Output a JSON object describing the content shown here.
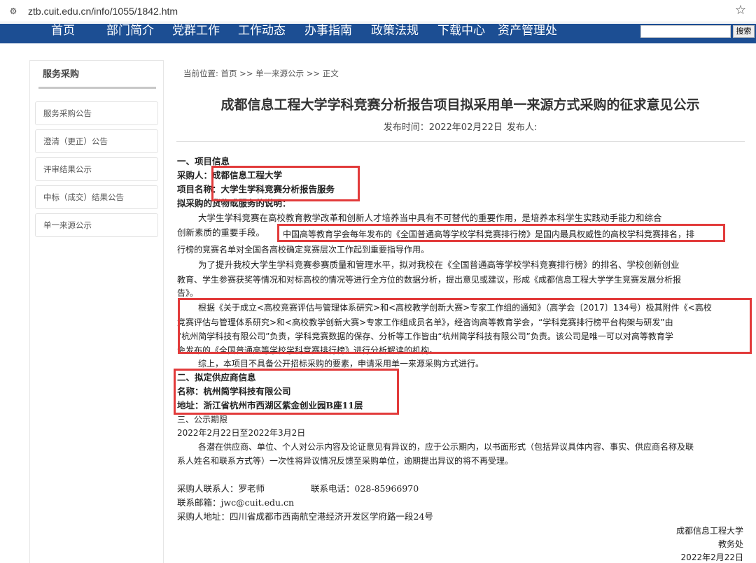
{
  "browser": {
    "url": "ztb.cuit.edu.cn/info/1055/1842.htm"
  },
  "nav": {
    "items": [
      "首页",
      "部门简介",
      "党群工作",
      "工作动态",
      "办事指南",
      "政策法规",
      "下载中心",
      "资产管理处"
    ],
    "search_button": "搜索",
    "search_placeholder": ""
  },
  "sidebar": {
    "title": "服务采购",
    "items": [
      "服务采购公告",
      "澄清（更正）公告",
      "评审结果公示",
      "中标（成交）结果公告",
      "单一来源公示"
    ]
  },
  "breadcrumb": {
    "label": "当前位置:",
    "path": "首页 >> 单一来源公示 >> 正文"
  },
  "article": {
    "title": "成都信息工程大学学科竞赛分析报告项目拟采用单一来源方式采购的征求意见公示",
    "publish_time": "发布时间：2022年02月22日",
    "publisher": "发布人:",
    "lines": [
      "一、项目信息",
      "采购人：成都信息工程大学",
      "项目名称：大学生学科竞赛分析报告服务",
      "拟采购的货物或服务的说明：",
      "大学生学科竞赛在高校教育教学改革和创新人才培养当中具有不可替代的重要作用，是培养本科学生实践动手能力和综合",
      "创新素质的重要手段。",
      "中国高等教育学会每年发布的《全国普通高等学校学科竞赛排行榜》是国内最具权威性的高校学科竞赛排名，排",
      "行榜的竞赛名单对全国各高校确定竞赛层次工作起到重要指导作用。",
      "为了提升我校大学生学科竞赛参赛质量和管理水平，拟对我校在《全国普通高等学校学科竞赛排行榜》的排名、学校创新创业",
      "教育、学生参赛获奖等情况和对标高校的情况等进行全方位的数据分析，提出意见或建议，形成《成都信息工程大学学生竞赛发展分析报",
      "告》。",
      "根据《关于成立<高校竞赛评估与管理体系研究>和<高校教学创新大赛>专家工作组的通知》（高学会〔2017〕134号）极其附件《<高校",
      "竞赛评估与管理体系研究>和<高校教学创新大赛>专家工作组成员名单》，经咨询高等教育学会，“学科竞赛排行榜平台构架与研发”由",
      "“杭州简学科技有限公司”负责，学科竞赛数据的保存、分析等工作皆由“杭州简学科技有限公司”负责。该公司是唯一可以对高等教育学",
      "会发布的《全国普通高等学校学科竞赛排行榜》进行分析解读的机构。",
      "综上，本项目不具备公开招标采购的要素，申请采用单一来源采购方式进行。",
      "二、拟定供应商信息",
      "名称：杭州简学科技有限公司",
      "地址：浙江省杭州市西湖区紫金创业园B座11层",
      "三、公示期限",
      "2022年2月22日至2022年3月2日",
      "各潜在供应商、单位、个人对公示内容及论证意见有异议的，应于公示期内，以书面形式（包括异议具体内容、事实、供应商名称及联",
      "系人姓名和联系方式等）一次性将异议情况反馈至采购单位，逾期提出异议的将不再受理。"
    ],
    "contact_person": "采购人联系人：罗老师",
    "contact_phone": "联系电话：028-85966970",
    "contact_email": "联系邮箱：jwc@cuit.edu.cn",
    "contact_address": "采购人地址：四川省成都市西南航空港经济开发区学府路一段24号",
    "signature_org": "成都信息工程大学",
    "signature_dept": "教务处",
    "signature_date": "2022年2月22日"
  },
  "colors": {
    "nav_bg": "#1c4e93",
    "highlight_box": "#e23b3b"
  },
  "icons": [
    "site-settings-icon",
    "bookmark-star-icon"
  ]
}
